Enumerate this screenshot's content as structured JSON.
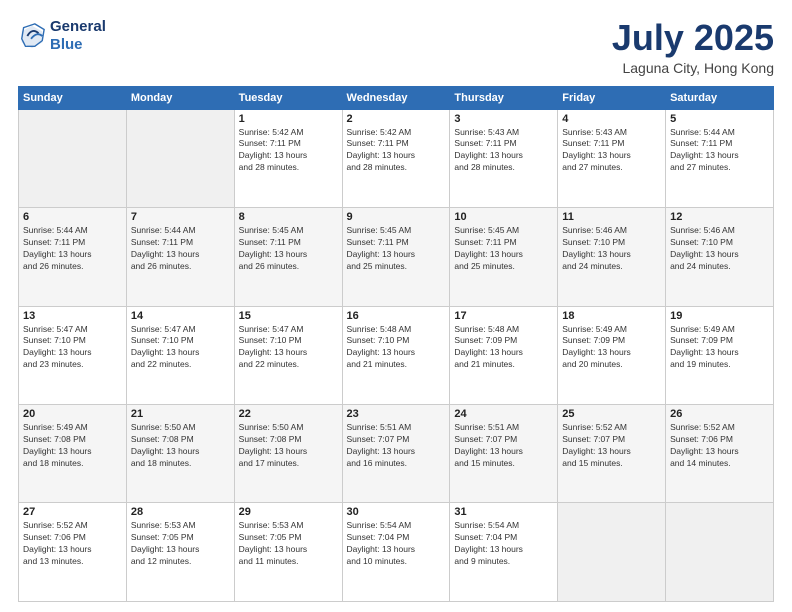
{
  "header": {
    "logo_line1": "General",
    "logo_line2": "Blue",
    "title": "July 2025",
    "subtitle": "Laguna City, Hong Kong"
  },
  "weekdays": [
    "Sunday",
    "Monday",
    "Tuesday",
    "Wednesday",
    "Thursday",
    "Friday",
    "Saturday"
  ],
  "weeks": [
    [
      {
        "day": "",
        "info": ""
      },
      {
        "day": "",
        "info": ""
      },
      {
        "day": "1",
        "info": "Sunrise: 5:42 AM\nSunset: 7:11 PM\nDaylight: 13 hours\nand 28 minutes."
      },
      {
        "day": "2",
        "info": "Sunrise: 5:42 AM\nSunset: 7:11 PM\nDaylight: 13 hours\nand 28 minutes."
      },
      {
        "day": "3",
        "info": "Sunrise: 5:43 AM\nSunset: 7:11 PM\nDaylight: 13 hours\nand 28 minutes."
      },
      {
        "day": "4",
        "info": "Sunrise: 5:43 AM\nSunset: 7:11 PM\nDaylight: 13 hours\nand 27 minutes."
      },
      {
        "day": "5",
        "info": "Sunrise: 5:44 AM\nSunset: 7:11 PM\nDaylight: 13 hours\nand 27 minutes."
      }
    ],
    [
      {
        "day": "6",
        "info": "Sunrise: 5:44 AM\nSunset: 7:11 PM\nDaylight: 13 hours\nand 26 minutes."
      },
      {
        "day": "7",
        "info": "Sunrise: 5:44 AM\nSunset: 7:11 PM\nDaylight: 13 hours\nand 26 minutes."
      },
      {
        "day": "8",
        "info": "Sunrise: 5:45 AM\nSunset: 7:11 PM\nDaylight: 13 hours\nand 26 minutes."
      },
      {
        "day": "9",
        "info": "Sunrise: 5:45 AM\nSunset: 7:11 PM\nDaylight: 13 hours\nand 25 minutes."
      },
      {
        "day": "10",
        "info": "Sunrise: 5:45 AM\nSunset: 7:11 PM\nDaylight: 13 hours\nand 25 minutes."
      },
      {
        "day": "11",
        "info": "Sunrise: 5:46 AM\nSunset: 7:10 PM\nDaylight: 13 hours\nand 24 minutes."
      },
      {
        "day": "12",
        "info": "Sunrise: 5:46 AM\nSunset: 7:10 PM\nDaylight: 13 hours\nand 24 minutes."
      }
    ],
    [
      {
        "day": "13",
        "info": "Sunrise: 5:47 AM\nSunset: 7:10 PM\nDaylight: 13 hours\nand 23 minutes."
      },
      {
        "day": "14",
        "info": "Sunrise: 5:47 AM\nSunset: 7:10 PM\nDaylight: 13 hours\nand 22 minutes."
      },
      {
        "day": "15",
        "info": "Sunrise: 5:47 AM\nSunset: 7:10 PM\nDaylight: 13 hours\nand 22 minutes."
      },
      {
        "day": "16",
        "info": "Sunrise: 5:48 AM\nSunset: 7:10 PM\nDaylight: 13 hours\nand 21 minutes."
      },
      {
        "day": "17",
        "info": "Sunrise: 5:48 AM\nSunset: 7:09 PM\nDaylight: 13 hours\nand 21 minutes."
      },
      {
        "day": "18",
        "info": "Sunrise: 5:49 AM\nSunset: 7:09 PM\nDaylight: 13 hours\nand 20 minutes."
      },
      {
        "day": "19",
        "info": "Sunrise: 5:49 AM\nSunset: 7:09 PM\nDaylight: 13 hours\nand 19 minutes."
      }
    ],
    [
      {
        "day": "20",
        "info": "Sunrise: 5:49 AM\nSunset: 7:08 PM\nDaylight: 13 hours\nand 18 minutes."
      },
      {
        "day": "21",
        "info": "Sunrise: 5:50 AM\nSunset: 7:08 PM\nDaylight: 13 hours\nand 18 minutes."
      },
      {
        "day": "22",
        "info": "Sunrise: 5:50 AM\nSunset: 7:08 PM\nDaylight: 13 hours\nand 17 minutes."
      },
      {
        "day": "23",
        "info": "Sunrise: 5:51 AM\nSunset: 7:07 PM\nDaylight: 13 hours\nand 16 minutes."
      },
      {
        "day": "24",
        "info": "Sunrise: 5:51 AM\nSunset: 7:07 PM\nDaylight: 13 hours\nand 15 minutes."
      },
      {
        "day": "25",
        "info": "Sunrise: 5:52 AM\nSunset: 7:07 PM\nDaylight: 13 hours\nand 15 minutes."
      },
      {
        "day": "26",
        "info": "Sunrise: 5:52 AM\nSunset: 7:06 PM\nDaylight: 13 hours\nand 14 minutes."
      }
    ],
    [
      {
        "day": "27",
        "info": "Sunrise: 5:52 AM\nSunset: 7:06 PM\nDaylight: 13 hours\nand 13 minutes."
      },
      {
        "day": "28",
        "info": "Sunrise: 5:53 AM\nSunset: 7:05 PM\nDaylight: 13 hours\nand 12 minutes."
      },
      {
        "day": "29",
        "info": "Sunrise: 5:53 AM\nSunset: 7:05 PM\nDaylight: 13 hours\nand 11 minutes."
      },
      {
        "day": "30",
        "info": "Sunrise: 5:54 AM\nSunset: 7:04 PM\nDaylight: 13 hours\nand 10 minutes."
      },
      {
        "day": "31",
        "info": "Sunrise: 5:54 AM\nSunset: 7:04 PM\nDaylight: 13 hours\nand 9 minutes."
      },
      {
        "day": "",
        "info": ""
      },
      {
        "day": "",
        "info": ""
      }
    ]
  ]
}
